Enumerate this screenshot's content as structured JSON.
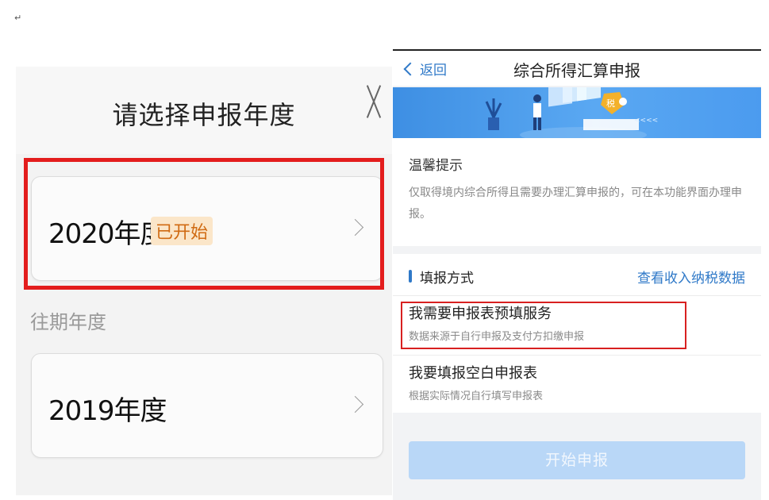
{
  "doc": {
    "paragraph_mark": "↵"
  },
  "left": {
    "title": "请选择申报年度",
    "current_year": {
      "label": "2020年度",
      "badge": "已开始"
    },
    "past_section_label": "往期年度",
    "past_year": {
      "label": "2019年度"
    }
  },
  "right": {
    "nav": {
      "back_label": "返回",
      "title": "综合所得汇算申报"
    },
    "banner": {
      "tax_sign": "税",
      "arrows": "<<<<"
    },
    "tip": {
      "title": "温馨提示",
      "body": "仅取得境内综合所得且需要办理汇算申报的，可在本功能界面办理申报。"
    },
    "method": {
      "title": "填报方式",
      "link": "查看收入纳税数据",
      "options": [
        {
          "title": "我需要申报表预填服务",
          "subtitle": "数据来源于自行申报及支付方扣缴申报"
        },
        {
          "title": "我要填报空白申报表",
          "subtitle": "根据实际情况自行填写申报表"
        }
      ]
    },
    "start_button": "开始申报"
  },
  "colors": {
    "highlight_red": "#e31d1d",
    "link_blue": "#2f79c8",
    "badge_bg": "#fbe6c9",
    "badge_text": "#d06a12",
    "button_disabled": "#b9d7f7"
  }
}
